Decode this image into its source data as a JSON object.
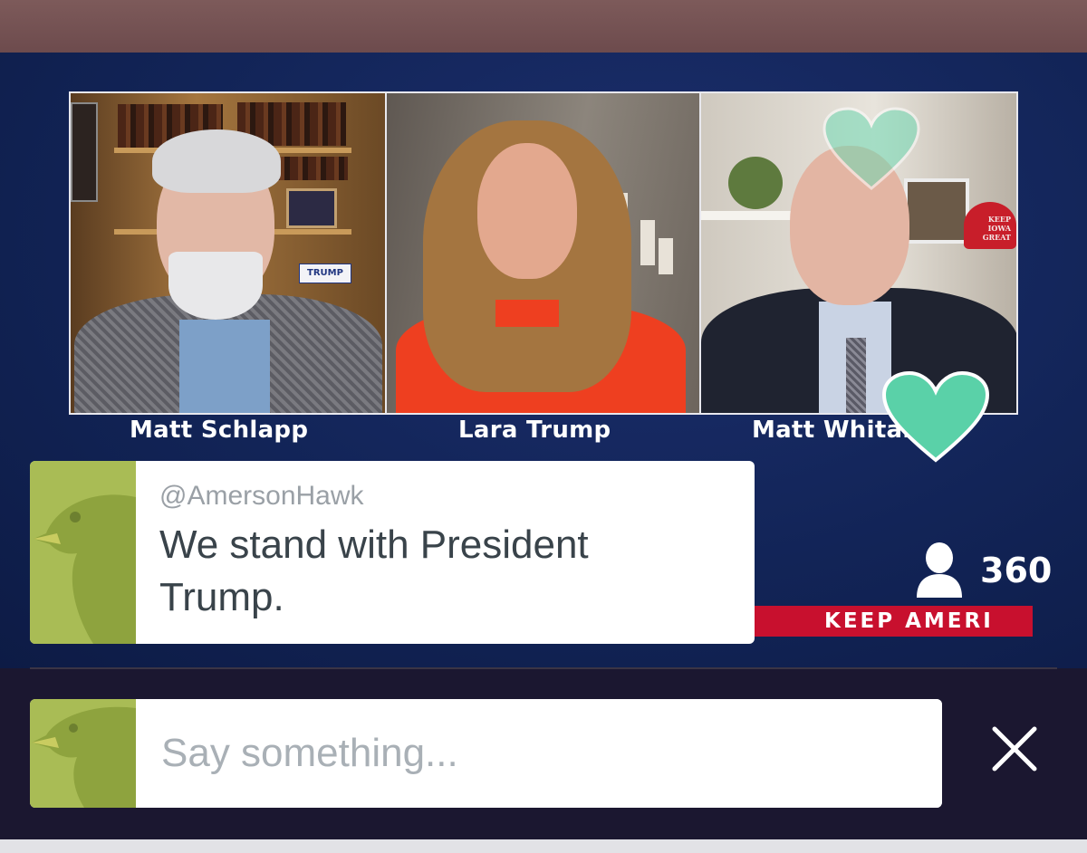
{
  "stream": {
    "participants": [
      {
        "name": "Matt Schlapp"
      },
      {
        "name": "Lara Trump"
      },
      {
        "name": "Matt Whitaker"
      }
    ],
    "viewers": {
      "count": "360",
      "icon": "person-icon"
    },
    "banner": "KEEP AMERI",
    "props": {
      "trump_sign": "TRUMP",
      "hat_text": "KEEP IOWA GREAT"
    },
    "reaction_icon": "heart-icon",
    "reaction_color": "#5ad1a8",
    "banner_color": "#c8102e"
  },
  "comment": {
    "username": "@AmersonHawk",
    "text": "We stand with President Trump.",
    "avatar_icon": "eagle-icon"
  },
  "composer": {
    "placeholder": "Say something...",
    "close_icon": "close-icon"
  }
}
